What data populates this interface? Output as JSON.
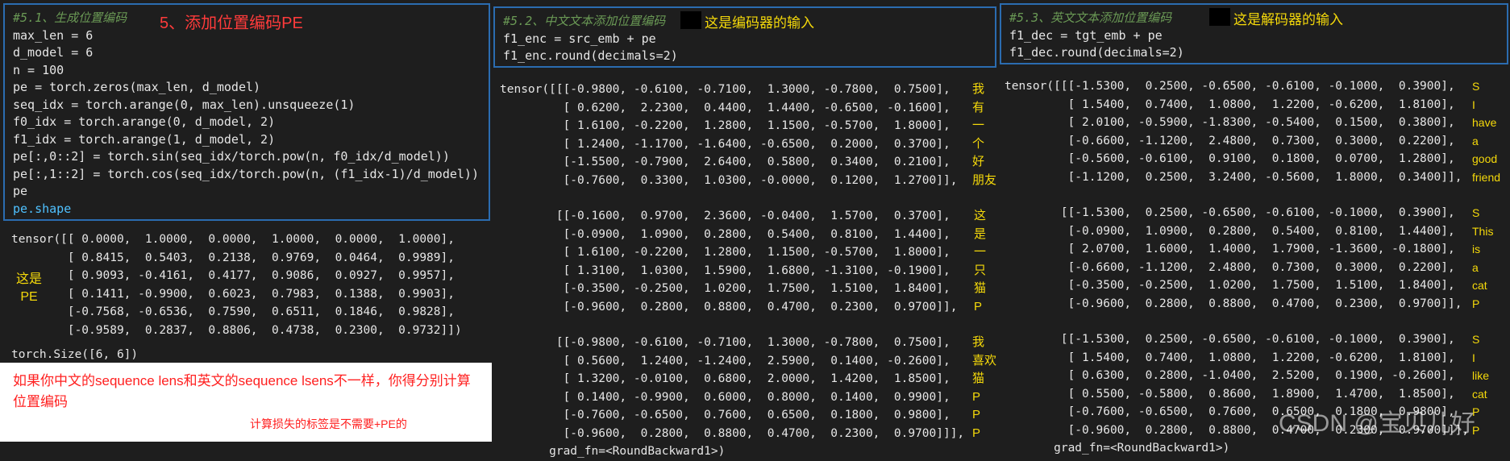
{
  "left": {
    "comment": "#5.1、生成位置编码",
    "heading": "5、添加位置编码PE",
    "code": [
      "max_len = 6",
      "d_model = 6",
      "n = 100",
      "pe = torch.zeros(max_len, d_model)",
      "seq_idx = torch.arange(0, max_len).unsqueeze(1)",
      "f0_idx = torch.arange(0, d_model, 2)",
      "f1_idx = torch.arange(1, d_model, 2)",
      "pe[:,0::2] = torch.sin(seq_idx/torch.pow(n, f0_idx/d_model))",
      "pe[:,1::2] = torch.cos(seq_idx/torch.pow(n, (f1_idx-1)/d_model))",
      "pe",
      "pe.shape"
    ],
    "output": [
      "tensor([[ 0.0000,  1.0000,  0.0000,  1.0000,  0.0000,  1.0000],",
      "        [ 0.8415,  0.5403,  0.2138,  0.9769,  0.0464,  0.9989],",
      "        [ 0.9093, -0.4161,  0.4177,  0.9086,  0.0927,  0.9957],",
      "        [ 0.1411, -0.9900,  0.6023,  0.7983,  0.1388,  0.9903],",
      "        [-0.7568, -0.6536,  0.7590,  0.6511,  0.1846,  0.9828],",
      "        [-0.9589,  0.2837,  0.8806,  0.4738,  0.2300,  0.9732]])"
    ],
    "pe_label_1": "这是",
    "pe_label_2": "PE",
    "size": "torch.Size([6, 6])",
    "note1": "如果你中文的sequence lens和英文的sequence lsens不一样，你得分别计算位置编码",
    "note2": "计算损失的标签是不需要+PE的"
  },
  "middle": {
    "comment": "#5.2、中文文本添加位置编码",
    "heading": "这是编码器的输入",
    "code": [
      "f1_enc = src_emb + pe",
      "f1_enc.round(decimals=2)"
    ],
    "output": [
      "tensor([[[-0.9800, -0.6100, -0.7100,  1.3000, -0.7800,  0.7500],",
      "         [ 0.6200,  2.2300,  0.4400,  1.4400, -0.6500, -0.1600],",
      "         [ 1.6100, -0.2200,  1.2800,  1.1500, -0.5700,  1.8000],",
      "         [ 1.2400, -1.1700, -1.6400, -0.6500,  0.2000,  0.3700],",
      "         [-1.5500, -0.7900,  2.6400,  0.5800,  0.3400,  0.2100],",
      "         [-0.7600,  0.3300,  1.0300, -0.0000,  0.1200,  1.2700]],",
      "",
      "        [[-0.1600,  0.9700,  2.3600, -0.0400,  1.5700,  0.3700],",
      "         [-0.0900,  1.0900,  0.2800,  0.5400,  0.8100,  1.4400],",
      "         [ 1.6100, -0.2200,  1.2800,  1.1500, -0.5700,  1.8000],",
      "         [ 1.3100,  1.0300,  1.5900,  1.6800, -1.3100, -0.1900],",
      "         [-0.3500, -0.2500,  1.0200,  1.7500,  1.5100,  1.8400],",
      "         [-0.9600,  0.2800,  0.8800,  0.4700,  0.2300,  0.9700]],",
      "",
      "        [[-0.9800, -0.6100, -0.7100,  1.3000, -0.7800,  0.7500],",
      "         [ 0.5600,  1.2400, -1.2400,  2.5900,  0.1400, -0.2600],",
      "         [ 1.3200, -0.0100,  0.6800,  2.0000,  1.4200,  1.8500],",
      "         [ 0.1400, -0.9900,  0.6000,  0.8000,  0.1400,  0.9900],",
      "         [-0.7600, -0.6500,  0.7600,  0.6500,  0.1800,  0.9800],",
      "         [-0.9600,  0.2800,  0.8800,  0.4700,  0.2300,  0.9700]]],"
    ],
    "grad": "       grad_fn=<RoundBackward1>)",
    "tokens_1": [
      "我",
      "有",
      "一",
      "个",
      "好",
      "朋友"
    ],
    "tokens_2": [
      "这",
      "是",
      "一",
      "只",
      "猫",
      "P"
    ],
    "tokens_3": [
      "我",
      "喜欢",
      "猫",
      "P",
      "P",
      "P"
    ]
  },
  "right": {
    "comment": "#5.3、英文文本添加位置编码",
    "heading": "这是解码器的输入",
    "code": [
      "f1_dec = tgt_emb + pe",
      "f1_dec.round(decimals=2)"
    ],
    "output": [
      "tensor([[[-1.5300,  0.2500, -0.6500, -0.6100, -0.1000,  0.3900],",
      "         [ 1.5400,  0.7400,  1.0800,  1.2200, -0.6200,  1.8100],",
      "         [ 2.0100, -0.5900, -1.8300, -0.5400,  0.1500,  0.3800],",
      "         [-0.6600, -1.1200,  2.4800,  0.7300,  0.3000,  0.2200],",
      "         [-0.5600, -0.6100,  0.9100,  0.1800,  0.0700,  1.2800],",
      "         [-1.1200,  0.2500,  3.2400, -0.5600,  1.8000,  0.3400]],",
      "",
      "        [[-1.5300,  0.2500, -0.6500, -0.6100, -0.1000,  0.3900],",
      "         [-0.0900,  1.0900,  0.2800,  0.5400,  0.8100,  1.4400],",
      "         [ 2.0700,  1.6000,  1.4000,  1.7900, -1.3600, -0.1800],",
      "         [-0.6600, -1.1200,  2.4800,  0.7300,  0.3000,  0.2200],",
      "         [-0.3500, -0.2500,  1.0200,  1.7500,  1.5100,  1.8400],",
      "         [-0.9600,  0.2800,  0.8800,  0.4700,  0.2300,  0.9700]],",
      "",
      "        [[-1.5300,  0.2500, -0.6500, -0.6100, -0.1000,  0.3900],",
      "         [ 1.5400,  0.7400,  1.0800,  1.2200, -0.6200,  1.8100],",
      "         [ 0.6300,  0.2800, -1.0400,  2.5200,  0.1900, -0.2600],",
      "         [ 0.5500, -0.5800,  0.8600,  1.8900,  1.4700,  1.8500],",
      "         [-0.7600, -0.6500,  0.7600,  0.6500,  0.1800,  0.9800],",
      "         [-0.9600,  0.2800,  0.8800,  0.4700,  0.2300,  0.9700]]],"
    ],
    "grad": "       grad_fn=<RoundBackward1>)",
    "tokens_1": [
      "S",
      "I",
      "have",
      "a",
      "good",
      "friend"
    ],
    "tokens_2": [
      "S",
      "This",
      "is",
      "a",
      "cat",
      "P"
    ],
    "tokens_3": [
      "S",
      "I",
      "like",
      "cat",
      "P",
      "P"
    ],
    "watermark": "CSDN @宝贝儿好"
  }
}
